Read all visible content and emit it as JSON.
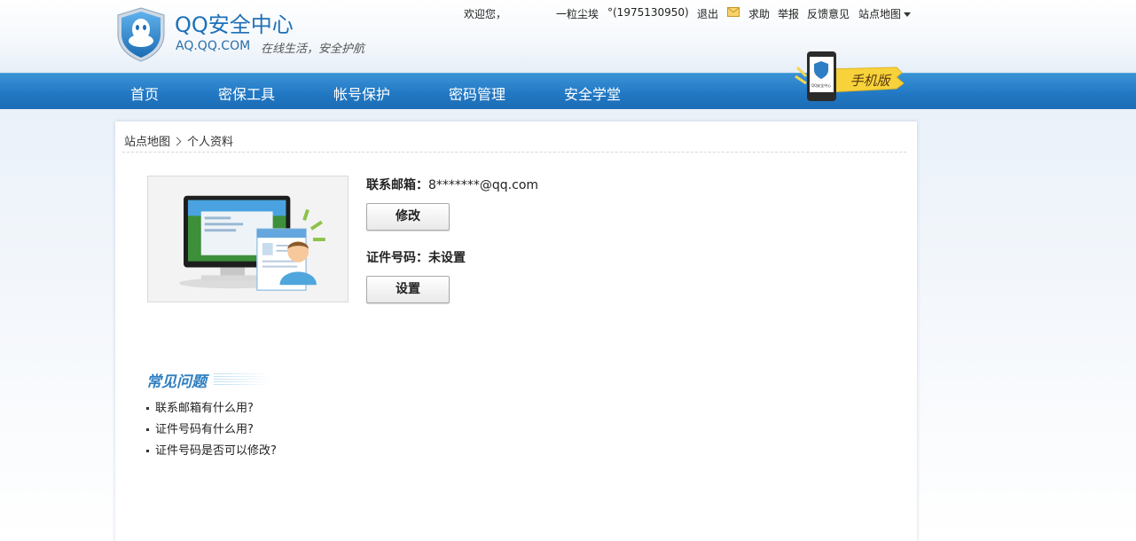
{
  "header": {
    "brand": "QQ安全中心",
    "domain": "AQ.QQ.COM",
    "slogan": "在线生活，安全护航"
  },
  "topbar": {
    "welcome": "欢迎您，",
    "nickname": "一粒尘埃",
    "qq": "°(1975130950)",
    "logout": "退出",
    "help": "求助",
    "report": "举报",
    "feedback": "反馈意见",
    "sitemap": "站点地图"
  },
  "nav": {
    "items": [
      "首页",
      "密保工具",
      "帐号保护",
      "密码管理",
      "安全学堂"
    ],
    "mobile_badge": "手机版",
    "mobile_screen_text": "QQ安全中心"
  },
  "breadcrumb": {
    "root": "站点地图",
    "current": "个人资料"
  },
  "profile": {
    "email_label": "联系邮箱：",
    "email_value": "8*******@qq.com",
    "email_button": "修改",
    "id_label": "证件号码：",
    "id_value": "未设置",
    "id_button": "设置"
  },
  "faq": {
    "title": "常见问题",
    "items": [
      "联系邮箱有什么用?",
      "证件号码有什么用?",
      "证件号码是否可以修改?"
    ]
  },
  "colors": {
    "nav_blue": "#2379c4",
    "brand_blue": "#1e6fb8",
    "badge_yellow": "#f7d23a"
  }
}
